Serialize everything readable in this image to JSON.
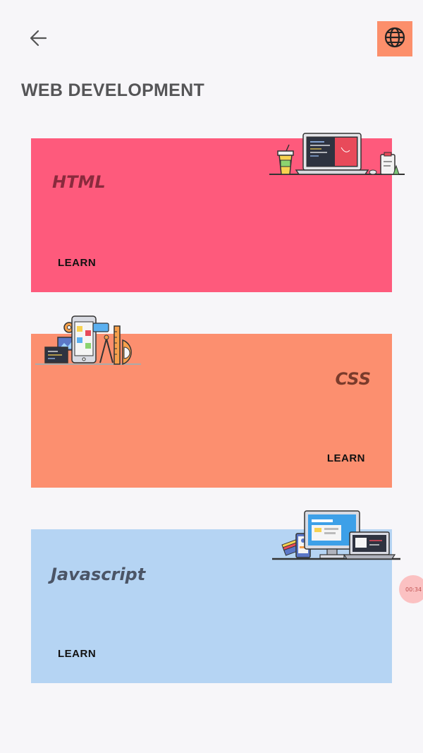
{
  "header": {
    "back_icon": "arrow-left-icon",
    "globe_icon": "globe-icon",
    "accent": "#fc8f6b"
  },
  "page": {
    "title": "WEB DEVELOPMENT"
  },
  "cards": [
    {
      "title": "HTML",
      "learn_label": "LEARN",
      "color": "#fe5a7c",
      "illustration": "laptop-desk-icon"
    },
    {
      "title": "CSS",
      "learn_label": "LEARN",
      "color": "#fc8f6f",
      "illustration": "mobile-design-tools-icon"
    },
    {
      "title": "Javascript",
      "learn_label": "LEARN",
      "color": "#b5d4f3",
      "illustration": "desktop-devices-icon"
    }
  ],
  "overlay": {
    "timer_text": "00:34"
  }
}
